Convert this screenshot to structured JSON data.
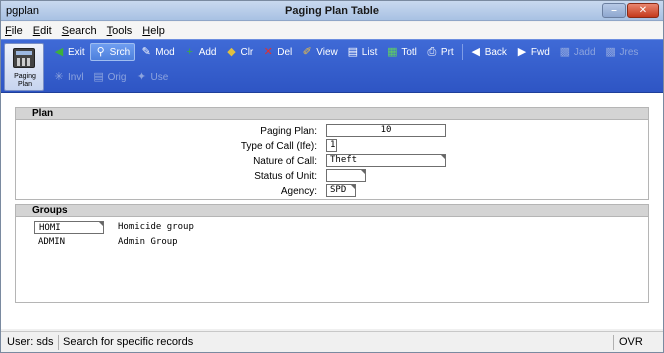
{
  "window": {
    "app_name": "pgplan",
    "title": "Paging Plan Table",
    "minimize_glyph": "–",
    "close_glyph": "✕"
  },
  "menu": [
    {
      "label": "File",
      "key": "F",
      "rest": "ile"
    },
    {
      "label": "Edit",
      "key": "E",
      "rest": "dit"
    },
    {
      "label": "Search",
      "key": "S",
      "rest": "earch"
    },
    {
      "label": "Tools",
      "key": "T",
      "rest": "ools"
    },
    {
      "label": "Help",
      "key": "H",
      "rest": "elp"
    }
  ],
  "toolbar": {
    "module_label": "Paging\nPlan",
    "row1": [
      {
        "label": "Exit",
        "icon": "exit-icon",
        "glyph": "◀",
        "color": "#3cb03c",
        "state": "normal"
      },
      {
        "label": "Srch",
        "icon": "search-icon",
        "glyph": "⚲",
        "color": "#ffffff",
        "state": "active"
      },
      {
        "label": "Mod",
        "icon": "modify-icon",
        "glyph": "✎",
        "color": "#ffffff",
        "state": "normal"
      },
      {
        "label": "Add",
        "icon": "add-icon",
        "glyph": "+",
        "color": "#3cb03c",
        "state": "normal"
      },
      {
        "label": "Clr",
        "icon": "clear-icon",
        "glyph": "◆",
        "color": "#e0c040",
        "state": "normal"
      },
      {
        "label": "Del",
        "icon": "delete-icon",
        "glyph": "✕",
        "color": "#e03030",
        "state": "normal"
      },
      {
        "label": "View",
        "icon": "view-icon",
        "glyph": "✐",
        "color": "#f0c040",
        "state": "normal"
      },
      {
        "label": "List",
        "icon": "list-icon",
        "glyph": "▤",
        "color": "#ffffff",
        "state": "normal"
      },
      {
        "label": "Totl",
        "icon": "total-icon",
        "glyph": "▦",
        "color": "#60d060",
        "state": "normal"
      },
      {
        "label": "Prt",
        "icon": "print-icon",
        "glyph": "⎙",
        "color": "#ffffff",
        "state": "normal"
      },
      {
        "label": "Back",
        "icon": "back-icon",
        "glyph": "◀",
        "color": "#ffffff",
        "state": "normal"
      },
      {
        "label": "Fwd",
        "icon": "forward-icon",
        "glyph": "▶",
        "color": "#ffffff",
        "state": "normal"
      },
      {
        "label": "Jadd",
        "icon": "jadd-icon",
        "glyph": "▩",
        "color": "#8da4de",
        "state": "disabled"
      },
      {
        "label": "Jres",
        "icon": "jres-icon",
        "glyph": "▩",
        "color": "#8da4de",
        "state": "disabled"
      }
    ],
    "row2": [
      {
        "label": "Invl",
        "icon": "involvement-icon",
        "glyph": "✳",
        "color": "#8da4de",
        "state": "disabled"
      },
      {
        "label": "Orig",
        "icon": "original-icon",
        "glyph": "▤",
        "color": "#8da4de",
        "state": "disabled"
      },
      {
        "label": "Use",
        "icon": "use-icon",
        "glyph": "✦",
        "color": "#8da4de",
        "state": "disabled"
      }
    ]
  },
  "plan": {
    "heading": "Plan",
    "fields": [
      {
        "label": "Paging Plan:",
        "value": "10"
      },
      {
        "label": "Type of Call (Ife):",
        "value": "1"
      },
      {
        "label": "Nature of Call:",
        "value": "Theft"
      },
      {
        "label": "Status of Unit:",
        "value": ""
      },
      {
        "label": "Agency:",
        "value": "SPD"
      }
    ]
  },
  "groups": {
    "heading": "Groups",
    "rows": [
      {
        "code": "HOMI",
        "description": "Homicide group"
      },
      {
        "code": "ADMIN",
        "description": "Admin Group"
      }
    ]
  },
  "status": {
    "user": "User: sds",
    "message": "Search for specific records",
    "mode": "OVR"
  }
}
